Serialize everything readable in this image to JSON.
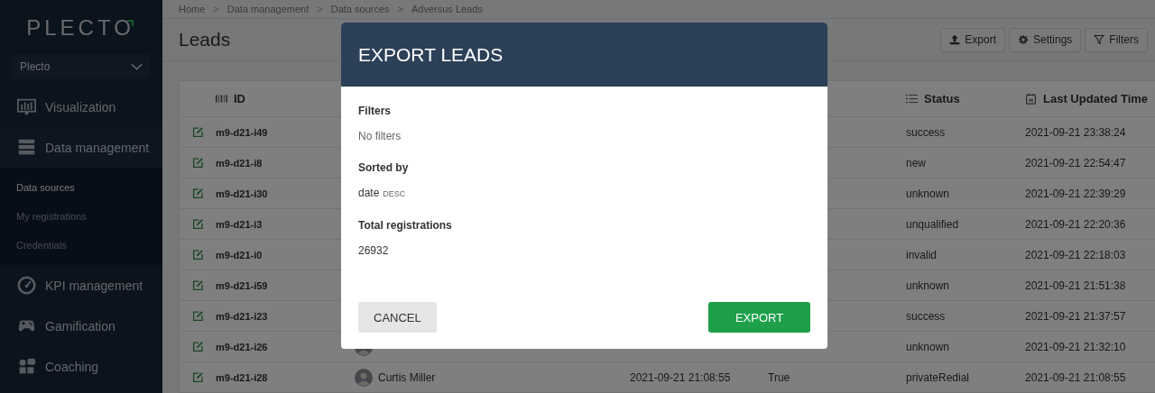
{
  "sidebar": {
    "logo": "PLECTO",
    "account": "Plecto",
    "items": [
      {
        "label": "Visualization"
      },
      {
        "label": "Data management",
        "children": [
          {
            "label": "Data sources",
            "selected": true
          },
          {
            "label": "My registrations",
            "selected": false
          },
          {
            "label": "Credentials",
            "selected": false
          }
        ]
      },
      {
        "label": "KPI management"
      },
      {
        "label": "Gamification"
      },
      {
        "label": "Coaching"
      }
    ]
  },
  "breadcrumb": [
    "Home",
    "Data management",
    "Data sources",
    "Adversus Leads"
  ],
  "breadcrumb_separator": ">",
  "page_title": "Leads",
  "toolbar": [
    {
      "label": "Export"
    },
    {
      "label": "Settings"
    },
    {
      "label": "Filters"
    }
  ],
  "table": {
    "columns": [
      {
        "label": "ID"
      },
      {
        "label": "Status"
      },
      {
        "label": "Last Updated Time"
      }
    ],
    "rows": [
      {
        "id": "m9-d21-i49",
        "status": "success",
        "updated": "2021-09-21 23:38:24"
      },
      {
        "id": "m9-d21-i8",
        "status": "new",
        "updated": "2021-09-21 22:54:47"
      },
      {
        "id": "m9-d21-i30",
        "status": "unknown",
        "updated": "2021-09-21 22:39:29"
      },
      {
        "id": "m9-d21-i3",
        "status": "unqualified",
        "updated": "2021-09-21 22:20:36"
      },
      {
        "id": "m9-d21-i0",
        "status": "invalid",
        "updated": "2021-09-21 22:18:03"
      },
      {
        "id": "m9-d21-i59",
        "status": "unknown",
        "updated": "2021-09-21 21:51:38"
      },
      {
        "id": "m9-d21-i23",
        "status": "success",
        "updated": "2021-09-21 21:37:57"
      },
      {
        "id": "m9-d21-i26",
        "avatar": true,
        "status": "unknown",
        "updated": "2021-09-21 21:32:10"
      },
      {
        "id": "m9-d21-i28",
        "avatar": true,
        "column_3": "Curtis Miller",
        "column_4": "2021-09-21 21:08:55",
        "column_5": "True",
        "status": "privateRedial",
        "updated": "2021-09-21 21:08:55"
      }
    ]
  },
  "modal": {
    "title": "EXPORT LEADS",
    "sections": [
      {
        "kind": "text",
        "label": "Filters",
        "value": "No filters"
      },
      {
        "kind": "sort",
        "label": "Sorted by",
        "value": "date",
        "order": "DESC"
      },
      {
        "kind": "count",
        "label": "Total registrations",
        "value": "26932"
      }
    ],
    "buttons": [
      {
        "label": "CANCEL",
        "kind": "secondary"
      },
      {
        "label": "EXPORT",
        "kind": "primary"
      }
    ]
  }
}
